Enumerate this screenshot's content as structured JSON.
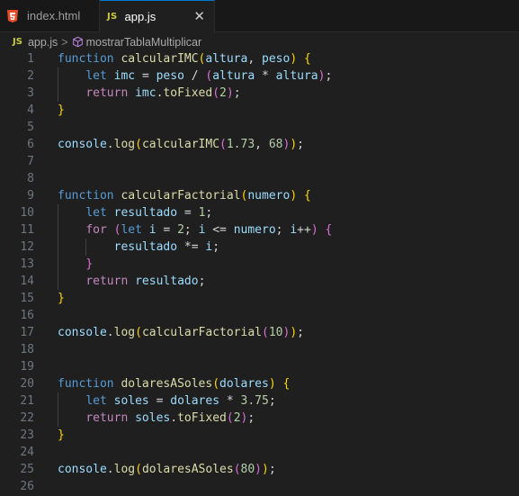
{
  "tabs": [
    {
      "label": "index.html",
      "icon": "html5-icon",
      "active": false
    },
    {
      "label": "app.js",
      "icon": "js-icon",
      "active": true,
      "badge": "JS"
    }
  ],
  "breadcrumb": {
    "badge": "JS",
    "file": "app.js",
    "separator": ">",
    "symbol": "mostrarTablaMultiplicar"
  },
  "editor": {
    "line_numbers": [
      "1",
      "2",
      "3",
      "4",
      "5",
      "6",
      "7",
      "8",
      "9",
      "10",
      "11",
      "12",
      "13",
      "14",
      "15",
      "16",
      "17",
      "18",
      "19",
      "20",
      "21",
      "22",
      "23",
      "24",
      "25",
      "26"
    ],
    "lines": [
      "function calcularIMC(altura, peso) {",
      "    let imc = peso / (altura * altura);",
      "    return imc.toFixed(2);",
      "}",
      "",
      "console.log(calcularIMC(1.73, 68));",
      "",
      "",
      "function calcularFactorial(numero) {",
      "    let resultado = 1;",
      "    for (let i = 2; i <= numero; i++) {",
      "        resultado *= i;",
      "    }",
      "    return resultado;",
      "}",
      "",
      "console.log(calcularFactorial(10));",
      "",
      "",
      "function dolaresASoles(dolares) {",
      "    let soles = dolares * 3.75;",
      "    return soles.toFixed(2);",
      "}",
      "",
      "console.log(dolaresASoles(80));",
      ""
    ]
  },
  "colors": {
    "keyword": "#569cd6",
    "control": "#c586c0",
    "function": "#dcdcaa",
    "variable": "#9cdcfe",
    "number": "#b5cea8",
    "bracket_level1": "#ffd700",
    "bracket_level2": "#da70d6",
    "bracket_level3": "#179fff",
    "accent": "#0078d4"
  }
}
